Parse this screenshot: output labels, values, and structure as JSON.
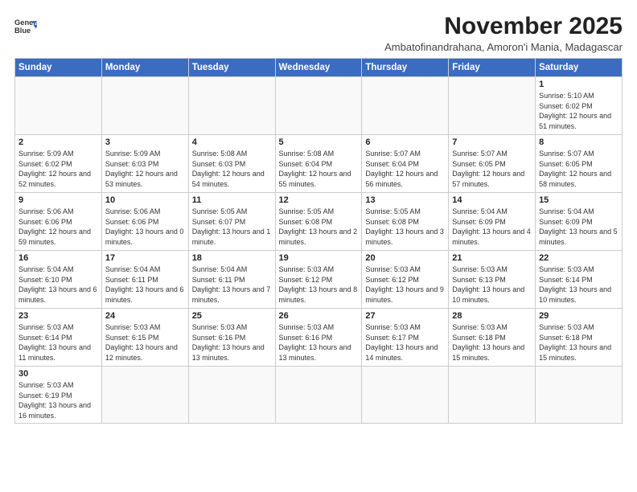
{
  "logo": {
    "line1": "General",
    "line2": "Blue"
  },
  "title": "November 2025",
  "subtitle": "Ambatofinandrahana, Amoron'i Mania, Madagascar",
  "days_header": [
    "Sunday",
    "Monday",
    "Tuesday",
    "Wednesday",
    "Thursday",
    "Friday",
    "Saturday"
  ],
  "weeks": [
    [
      {
        "num": "",
        "info": ""
      },
      {
        "num": "",
        "info": ""
      },
      {
        "num": "",
        "info": ""
      },
      {
        "num": "",
        "info": ""
      },
      {
        "num": "",
        "info": ""
      },
      {
        "num": "",
        "info": ""
      },
      {
        "num": "1",
        "info": "Sunrise: 5:10 AM\nSunset: 6:02 PM\nDaylight: 12 hours\nand 51 minutes."
      }
    ],
    [
      {
        "num": "2",
        "info": "Sunrise: 5:09 AM\nSunset: 6:02 PM\nDaylight: 12 hours\nand 52 minutes."
      },
      {
        "num": "3",
        "info": "Sunrise: 5:09 AM\nSunset: 6:03 PM\nDaylight: 12 hours\nand 53 minutes."
      },
      {
        "num": "4",
        "info": "Sunrise: 5:08 AM\nSunset: 6:03 PM\nDaylight: 12 hours\nand 54 minutes."
      },
      {
        "num": "5",
        "info": "Sunrise: 5:08 AM\nSunset: 6:04 PM\nDaylight: 12 hours\nand 55 minutes."
      },
      {
        "num": "6",
        "info": "Sunrise: 5:07 AM\nSunset: 6:04 PM\nDaylight: 12 hours\nand 56 minutes."
      },
      {
        "num": "7",
        "info": "Sunrise: 5:07 AM\nSunset: 6:05 PM\nDaylight: 12 hours\nand 57 minutes."
      },
      {
        "num": "8",
        "info": "Sunrise: 5:07 AM\nSunset: 6:05 PM\nDaylight: 12 hours\nand 58 minutes."
      }
    ],
    [
      {
        "num": "9",
        "info": "Sunrise: 5:06 AM\nSunset: 6:06 PM\nDaylight: 12 hours\nand 59 minutes."
      },
      {
        "num": "10",
        "info": "Sunrise: 5:06 AM\nSunset: 6:06 PM\nDaylight: 13 hours\nand 0 minutes."
      },
      {
        "num": "11",
        "info": "Sunrise: 5:05 AM\nSunset: 6:07 PM\nDaylight: 13 hours\nand 1 minute."
      },
      {
        "num": "12",
        "info": "Sunrise: 5:05 AM\nSunset: 6:08 PM\nDaylight: 13 hours\nand 2 minutes."
      },
      {
        "num": "13",
        "info": "Sunrise: 5:05 AM\nSunset: 6:08 PM\nDaylight: 13 hours\nand 3 minutes."
      },
      {
        "num": "14",
        "info": "Sunrise: 5:04 AM\nSunset: 6:09 PM\nDaylight: 13 hours\nand 4 minutes."
      },
      {
        "num": "15",
        "info": "Sunrise: 5:04 AM\nSunset: 6:09 PM\nDaylight: 13 hours\nand 5 minutes."
      }
    ],
    [
      {
        "num": "16",
        "info": "Sunrise: 5:04 AM\nSunset: 6:10 PM\nDaylight: 13 hours\nand 6 minutes."
      },
      {
        "num": "17",
        "info": "Sunrise: 5:04 AM\nSunset: 6:11 PM\nDaylight: 13 hours\nand 6 minutes."
      },
      {
        "num": "18",
        "info": "Sunrise: 5:04 AM\nSunset: 6:11 PM\nDaylight: 13 hours\nand 7 minutes."
      },
      {
        "num": "19",
        "info": "Sunrise: 5:03 AM\nSunset: 6:12 PM\nDaylight: 13 hours\nand 8 minutes."
      },
      {
        "num": "20",
        "info": "Sunrise: 5:03 AM\nSunset: 6:12 PM\nDaylight: 13 hours\nand 9 minutes."
      },
      {
        "num": "21",
        "info": "Sunrise: 5:03 AM\nSunset: 6:13 PM\nDaylight: 13 hours\nand 10 minutes."
      },
      {
        "num": "22",
        "info": "Sunrise: 5:03 AM\nSunset: 6:14 PM\nDaylight: 13 hours\nand 10 minutes."
      }
    ],
    [
      {
        "num": "23",
        "info": "Sunrise: 5:03 AM\nSunset: 6:14 PM\nDaylight: 13 hours\nand 11 minutes."
      },
      {
        "num": "24",
        "info": "Sunrise: 5:03 AM\nSunset: 6:15 PM\nDaylight: 13 hours\nand 12 minutes."
      },
      {
        "num": "25",
        "info": "Sunrise: 5:03 AM\nSunset: 6:16 PM\nDaylight: 13 hours\nand 13 minutes."
      },
      {
        "num": "26",
        "info": "Sunrise: 5:03 AM\nSunset: 6:16 PM\nDaylight: 13 hours\nand 13 minutes."
      },
      {
        "num": "27",
        "info": "Sunrise: 5:03 AM\nSunset: 6:17 PM\nDaylight: 13 hours\nand 14 minutes."
      },
      {
        "num": "28",
        "info": "Sunrise: 5:03 AM\nSunset: 6:18 PM\nDaylight: 13 hours\nand 15 minutes."
      },
      {
        "num": "29",
        "info": "Sunrise: 5:03 AM\nSunset: 6:18 PM\nDaylight: 13 hours\nand 15 minutes."
      }
    ],
    [
      {
        "num": "30",
        "info": "Sunrise: 5:03 AM\nSunset: 6:19 PM\nDaylight: 13 hours\nand 16 minutes."
      },
      {
        "num": "",
        "info": ""
      },
      {
        "num": "",
        "info": ""
      },
      {
        "num": "",
        "info": ""
      },
      {
        "num": "",
        "info": ""
      },
      {
        "num": "",
        "info": ""
      },
      {
        "num": "",
        "info": ""
      }
    ]
  ]
}
